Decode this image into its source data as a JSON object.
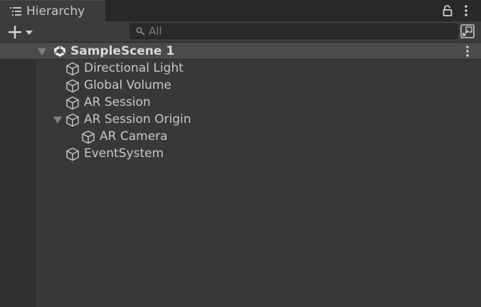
{
  "window": {
    "tab_title": "Hierarchy",
    "tab_icon": "hierarchy-list-icon",
    "lock_icon": "lock-icon",
    "menu_icon": "kebab-menu-icon"
  },
  "toolbar": {
    "add_icon": "plus-dropdown-icon",
    "search": {
      "placeholder": "All",
      "value": "",
      "icon": "search-icon"
    },
    "scene_visibility_icon": "scene-visibility-icon"
  },
  "hierarchy": {
    "scene": {
      "label": "SampleScene 1",
      "expanded": true,
      "icon": "unity-scene-icon"
    },
    "items": [
      {
        "label": "Directional Light",
        "depth": 0,
        "expandable": false,
        "icon": "gameobject-cube-icon"
      },
      {
        "label": "Global Volume",
        "depth": 0,
        "expandable": false,
        "icon": "gameobject-cube-icon"
      },
      {
        "label": "AR Session",
        "depth": 0,
        "expandable": false,
        "icon": "gameobject-cube-icon"
      },
      {
        "label": "AR Session Origin",
        "depth": 0,
        "expandable": true,
        "expanded": true,
        "icon": "gameobject-cube-icon"
      },
      {
        "label": "AR Camera",
        "depth": 1,
        "expandable": false,
        "icon": "gameobject-cube-icon"
      },
      {
        "label": "EventSystem",
        "depth": 0,
        "expandable": false,
        "icon": "gameobject-cube-icon"
      }
    ]
  },
  "colors": {
    "panel_bg": "#383838",
    "tab_bg": "#3c3c3c",
    "scene_row_bg": "#4b4b4b",
    "text": "#c8c8c8",
    "search_bg": "#2a2a2a"
  }
}
